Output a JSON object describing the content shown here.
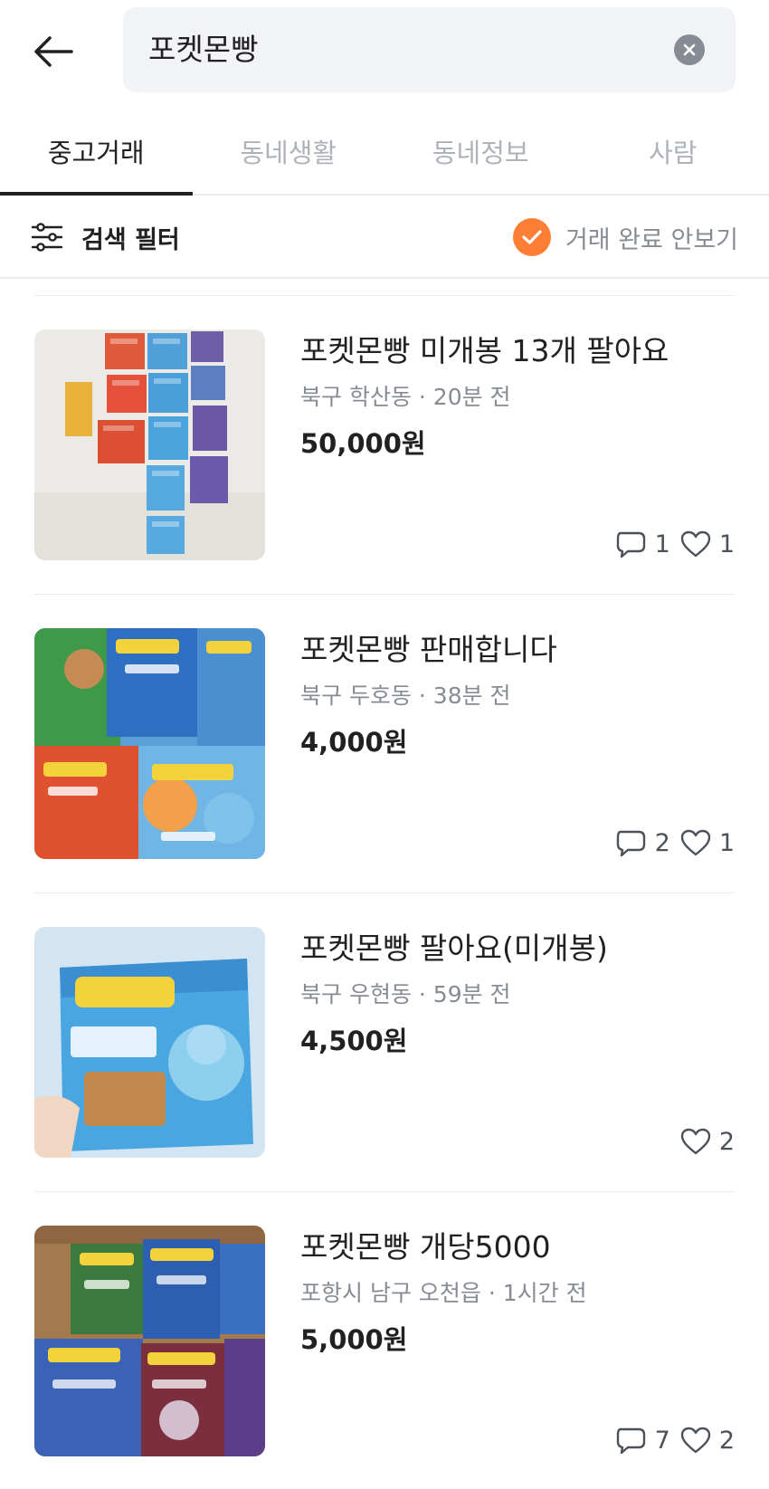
{
  "search": {
    "query": "포켓몬빵"
  },
  "tabs": [
    {
      "label": "중고거래",
      "active": true
    },
    {
      "label": "동네생활",
      "active": false
    },
    {
      "label": "동네정보",
      "active": false
    },
    {
      "label": "사람",
      "active": false
    }
  ],
  "filter": {
    "label": "검색 필터",
    "hide_completed_label": "거래 완료 안보기",
    "hide_completed_checked": true
  },
  "colors": {
    "accent": "#ff7e36",
    "text": "#212124",
    "subtext": "#868b94"
  },
  "listings": [
    {
      "title": "포켓몬빵 미개봉 13개 팔아요",
      "meta": "북구 학산동 · 20분 전",
      "price": "50,000원",
      "chats": "1",
      "likes": "1"
    },
    {
      "title": "포켓몬빵 판매합니다",
      "meta": "북구 두호동 · 38분 전",
      "price": "4,000원",
      "chats": "2",
      "likes": "1"
    },
    {
      "title": "포켓몬빵 팔아요(미개봉)",
      "meta": "북구 우현동 · 59분 전",
      "price": "4,500원",
      "chats": null,
      "likes": "2"
    },
    {
      "title": "포켓몬빵 개당5000",
      "meta": "포항시 남구 오천읍 · 1시간 전",
      "price": "5,000원",
      "chats": "7",
      "likes": "2"
    }
  ]
}
